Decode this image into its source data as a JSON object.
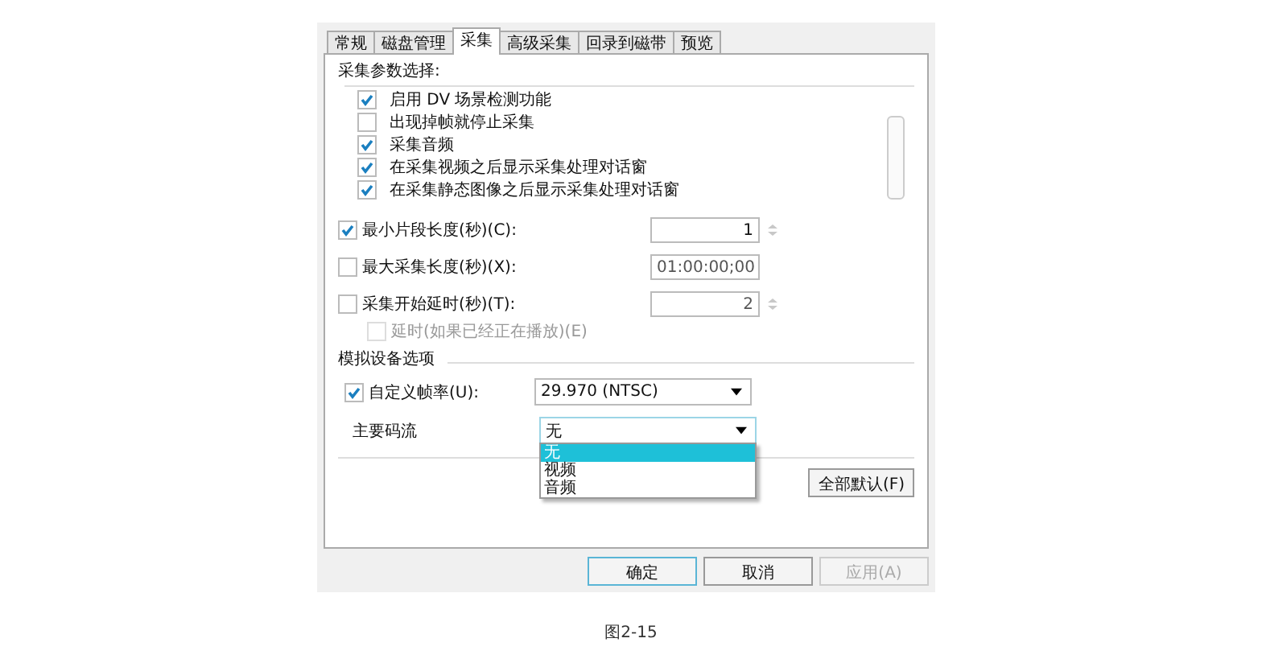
{
  "tabs": [
    {
      "label": "常规",
      "selected": false
    },
    {
      "label": "磁盘管理",
      "selected": false
    },
    {
      "label": "采集",
      "selected": true
    },
    {
      "label": "高级采集",
      "selected": false
    },
    {
      "label": "回录到磁带",
      "selected": false
    },
    {
      "label": "预览",
      "selected": false
    }
  ],
  "params": {
    "heading": "采集参数选择:",
    "items": [
      {
        "label": "启用 DV 场景检测功能",
        "checked": true
      },
      {
        "label": "出现掉帧就停止采集",
        "checked": false
      },
      {
        "label": "采集音频",
        "checked": true
      },
      {
        "label": "在采集视频之后显示采集处理对话窗",
        "checked": true
      },
      {
        "label": "在采集静态图像之后显示采集处理对话窗",
        "checked": true
      }
    ]
  },
  "fields": [
    {
      "label": "最小片段长度(秒)(C):",
      "checked": true,
      "value": "1",
      "spinner": true
    },
    {
      "label": "最大采集长度(秒)(X):",
      "checked": false,
      "value": "01:00:00;00",
      "spinner": false
    },
    {
      "label": "采集开始延时(秒)(T):",
      "checked": false,
      "value": "2",
      "spinner": true
    }
  ],
  "delay_option": {
    "label": "延时(如果已经正在播放)(E)",
    "checked": false,
    "disabled": true
  },
  "analog": {
    "heading": "模拟设备选项",
    "framerate": {
      "label": "自定义帧率(U):",
      "checked": true,
      "value": "29.970 (NTSC)"
    },
    "stream": {
      "label": "主要码流",
      "value": "无",
      "options": [
        {
          "label": "无",
          "selected": true
        },
        {
          "label": "视频",
          "selected": false
        },
        {
          "label": "音频",
          "selected": false
        }
      ]
    }
  },
  "defaults_button": "全部默认(F)",
  "buttons": [
    {
      "label": "确定",
      "disabled": false,
      "default": true
    },
    {
      "label": "取消",
      "disabled": false,
      "default": false
    },
    {
      "label": "应用(A)",
      "disabled": true,
      "default": false
    }
  ],
  "caption": "图2-15"
}
